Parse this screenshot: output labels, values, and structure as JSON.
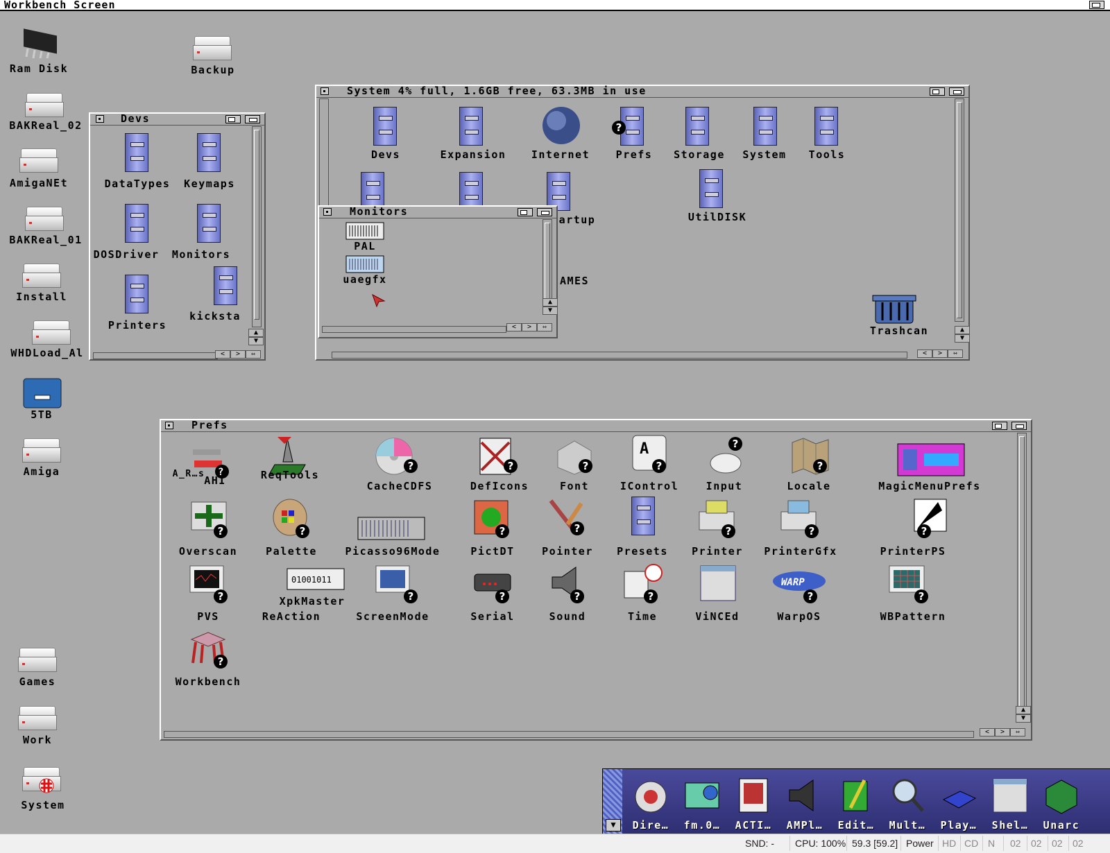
{
  "screen_title": "Workbench Screen",
  "desktop_icons": [
    "Ram Disk",
    "Backup",
    "BAKReal_02",
    "AmigaNEt",
    "BAKReal_01",
    "Install",
    "WHDLoad_Al",
    "5TB",
    "Amiga",
    "Games",
    "Work",
    "System"
  ],
  "devs_window": {
    "title": "Devs",
    "icons": [
      "DataTypes",
      "Keymaps",
      "DOSDriver",
      "Monitors",
      "Printers",
      "kicksta"
    ]
  },
  "system_window": {
    "title": "System  4% full, 1.6GB free, 63.3MB in use",
    "icons": [
      "Devs",
      "Expansion",
      "Internet",
      "Prefs",
      "Storage",
      "System",
      "Tools",
      "artup",
      "UtilDISK",
      "AMES",
      "Trashcan"
    ]
  },
  "monitors_window": {
    "title": "Monitors",
    "icons": [
      "PAL",
      "uaegfx"
    ]
  },
  "prefs_window": {
    "title": "Prefs",
    "icons": [
      "A_R…s",
      "AHI",
      "ReqTools",
      "CacheCDFS",
      "DefIcons",
      "Font",
      "IControl",
      "Input",
      "Locale",
      "MagicMenuPrefs",
      "Overscan",
      "Palette",
      "Picasso96Mode",
      "PictDT",
      "Pointer",
      "Presets",
      "Printer",
      "PrinterGfx",
      "PrinterPS",
      "PVS",
      "XpkMaster",
      "ReAction",
      "ScreenMode",
      "Serial",
      "Sound",
      "Time",
      "ViNCEd",
      "WarpOS",
      "WBPattern",
      "Workbench"
    ]
  },
  "dock": [
    "Dire…",
    "fm.0…",
    "ACTI…",
    "AMPl…",
    "Edit…",
    "Mult…",
    "Play…",
    "Shel…",
    "Unarc"
  ],
  "status": {
    "snd": "SND: -",
    "cpu": "CPU: 100%",
    "fps": "59.3 [59.2]",
    "power": "Power",
    "hd": "HD",
    "cd": "CD",
    "n": "N",
    "d0": "02",
    "d1": "02",
    "d2": "02",
    "d3": "02"
  }
}
